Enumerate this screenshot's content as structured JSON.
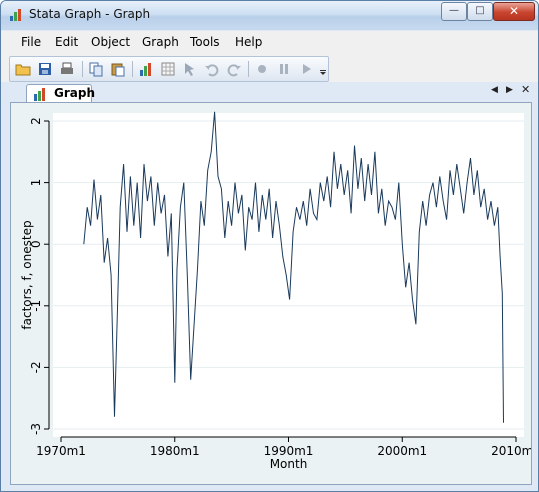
{
  "window": {
    "title": "Stata Graph - Graph"
  },
  "menu": [
    "File",
    "Edit",
    "Object",
    "Graph",
    "Tools",
    "Help"
  ],
  "toolbar": [
    "open-icon",
    "save-icon",
    "print-icon",
    "copy-icon",
    "paste-icon",
    "graph-editor-icon",
    "data-editor-icon",
    "pointer-icon",
    "undo-icon",
    "redo-icon",
    "record-icon",
    "pause-icon",
    "play-icon",
    "toolbar-dropdown-icon"
  ],
  "tab": {
    "label": "Graph"
  },
  "colors": {
    "line": "#1a3a5c",
    "plot_bg": "#ffffff",
    "graph_bg": "#eaf2f3"
  },
  "chart_data": {
    "type": "line",
    "title": "",
    "xlabel": "Month",
    "ylabel": "factors, f, onestep",
    "xlim": [
      1970,
      2010
    ],
    "ylim": [
      -3,
      2
    ],
    "xticks": [
      {
        "v": 1970,
        "label": "1970m1"
      },
      {
        "v": 1980,
        "label": "1980m1"
      },
      {
        "v": 1990,
        "label": "1990m1"
      },
      {
        "v": 2000,
        "label": "2000m1"
      },
      {
        "v": 2010,
        "label": "2010m1"
      }
    ],
    "yticks": [
      {
        "v": 2,
        "label": "2"
      },
      {
        "v": 1,
        "label": "1"
      },
      {
        "v": 0,
        "label": "0"
      },
      {
        "v": -1,
        "label": "-1"
      },
      {
        "v": -2,
        "label": "-2"
      },
      {
        "v": -3,
        "label": "-3"
      }
    ],
    "grid": true,
    "x": [
      1972.0,
      1972.3,
      1972.6,
      1972.9,
      1973.2,
      1973.5,
      1973.8,
      1974.1,
      1974.4,
      1974.7,
      1975.0,
      1975.2,
      1975.5,
      1975.8,
      1976.1,
      1976.4,
      1976.7,
      1977.0,
      1977.3,
      1977.6,
      1977.9,
      1978.2,
      1978.5,
      1978.8,
      1979.1,
      1979.4,
      1979.7,
      1980.0,
      1980.2,
      1980.5,
      1980.8,
      1981.1,
      1981.4,
      1981.7,
      1982.0,
      1982.3,
      1982.6,
      1982.9,
      1983.2,
      1983.5,
      1983.8,
      1984.1,
      1984.4,
      1984.7,
      1985.0,
      1985.3,
      1985.6,
      1985.9,
      1986.2,
      1986.5,
      1986.8,
      1987.1,
      1987.4,
      1987.7,
      1988.0,
      1988.3,
      1988.6,
      1988.9,
      1989.2,
      1989.5,
      1989.8,
      1990.1,
      1990.4,
      1990.7,
      1991.0,
      1991.3,
      1991.6,
      1991.9,
      1992.2,
      1992.5,
      1992.8,
      1993.1,
      1993.4,
      1993.7,
      1994.0,
      1994.3,
      1994.6,
      1994.9,
      1995.2,
      1995.5,
      1995.8,
      1996.1,
      1996.4,
      1996.7,
      1997.0,
      1997.3,
      1997.6,
      1997.9,
      1998.2,
      1998.5,
      1998.8,
      1999.1,
      1999.4,
      1999.7,
      2000.0,
      2000.3,
      2000.6,
      2000.9,
      2001.2,
      2001.5,
      2001.8,
      2002.1,
      2002.4,
      2002.7,
      2003.0,
      2003.3,
      2003.6,
      2003.9,
      2004.2,
      2004.5,
      2004.8,
      2005.1,
      2005.4,
      2005.7,
      2006.0,
      2006.3,
      2006.6,
      2006.9,
      2007.2,
      2007.5,
      2007.8,
      2008.1,
      2008.4,
      2008.6,
      2008.8,
      2008.9
    ],
    "y": [
      0.0,
      0.6,
      0.3,
      1.05,
      0.4,
      0.8,
      -0.3,
      0.1,
      -0.5,
      -2.8,
      -0.8,
      0.6,
      1.3,
      0.2,
      1.1,
      0.3,
      1.0,
      0.1,
      1.3,
      0.7,
      1.1,
      0.3,
      1.0,
      0.5,
      0.8,
      -0.2,
      0.5,
      -2.25,
      -0.4,
      0.6,
      1.0,
      -0.5,
      -2.2,
      -1.3,
      -0.4,
      0.7,
      0.3,
      1.2,
      1.5,
      2.15,
      1.1,
      0.9,
      0.1,
      0.7,
      0.3,
      1.0,
      0.5,
      0.8,
      -0.1,
      0.6,
      0.4,
      1.0,
      0.2,
      0.8,
      0.4,
      0.9,
      0.1,
      0.7,
      0.3,
      -0.2,
      -0.5,
      -0.9,
      0.2,
      0.6,
      0.4,
      0.7,
      0.3,
      0.9,
      0.5,
      0.4,
      1.0,
      0.7,
      1.1,
      0.6,
      1.5,
      0.9,
      1.3,
      0.8,
      1.2,
      0.5,
      1.6,
      0.9,
      1.4,
      0.7,
      1.3,
      0.8,
      1.5,
      0.5,
      0.9,
      0.3,
      0.7,
      0.6,
      0.4,
      1.0,
      0.0,
      -0.7,
      -0.3,
      -0.9,
      -1.3,
      0.2,
      0.7,
      0.3,
      0.8,
      1.0,
      0.6,
      1.1,
      0.7,
      0.4,
      1.2,
      0.8,
      1.3,
      0.9,
      0.5,
      1.0,
      1.4,
      0.8,
      1.2,
      0.6,
      0.9,
      0.4,
      0.7,
      0.3,
      0.6,
      -0.2,
      -0.8,
      -2.9
    ]
  }
}
